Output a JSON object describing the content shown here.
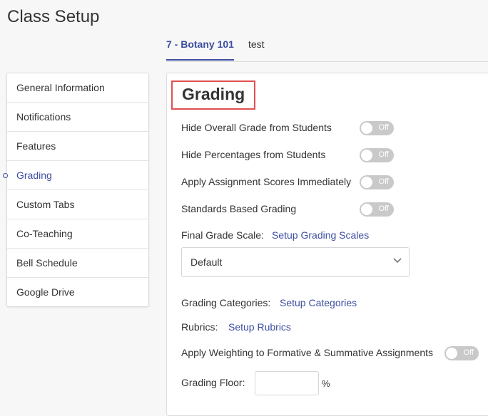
{
  "page": {
    "title": "Class Setup"
  },
  "tabs": [
    {
      "label": "7 - Botany 101",
      "active": true
    },
    {
      "label": "test",
      "active": false
    }
  ],
  "sidebar": {
    "items": [
      {
        "label": "General Information"
      },
      {
        "label": "Notifications"
      },
      {
        "label": "Features"
      },
      {
        "label": "Grading",
        "active": true
      },
      {
        "label": "Custom Tabs"
      },
      {
        "label": "Co-Teaching"
      },
      {
        "label": "Bell Schedule"
      },
      {
        "label": "Google Drive"
      }
    ]
  },
  "grading": {
    "title": "Grading",
    "toggles": [
      {
        "label": "Hide Overall Grade from Students",
        "state": "Off"
      },
      {
        "label": "Hide Percentages from Students",
        "state": "Off"
      },
      {
        "label": "Apply Assignment Scores Immediately",
        "state": "Off"
      },
      {
        "label": "Standards Based Grading",
        "state": "Off"
      }
    ],
    "final_grade_scale": {
      "label": "Final Grade Scale:",
      "link": "Setup Grading Scales",
      "selected": "Default"
    },
    "categories": {
      "label": "Grading Categories:",
      "link": "Setup Categories"
    },
    "rubrics": {
      "label": "Rubrics:",
      "link": "Setup Rubrics"
    },
    "weighting": {
      "label": "Apply Weighting to Formative & Summative Assignments",
      "state": "Off"
    },
    "floor": {
      "label": "Grading Floor:",
      "value": "",
      "unit": "%"
    }
  },
  "colors": {
    "accent": "#3d4ea0",
    "highlight_box": "#e15050",
    "toggle_off": "#c9c9c9"
  }
}
